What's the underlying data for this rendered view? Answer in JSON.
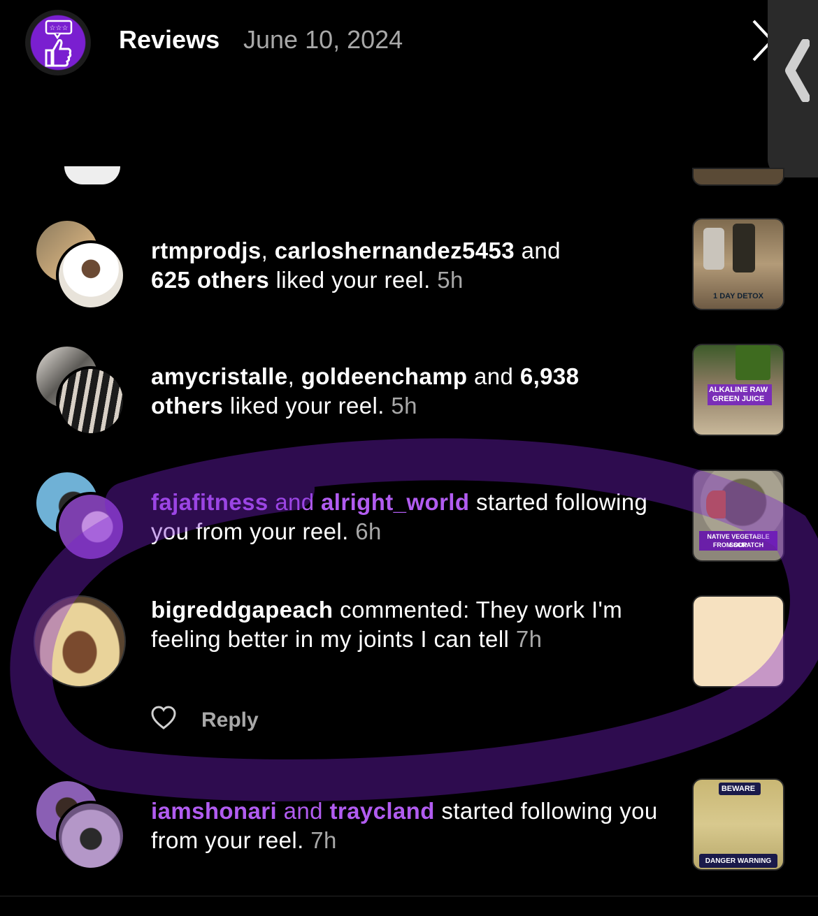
{
  "header": {
    "title": "Reviews",
    "date": "June 10, 2024"
  },
  "notifications": [
    {
      "user1": "rtmprodjs",
      "sep": ", ",
      "user2": "carloshernandez5453",
      "mid": " and ",
      "others": "625 others",
      "action": " liked your reel. ",
      "time": "5h",
      "thumb_caption": "1 DAY DETOX"
    },
    {
      "user1": "amycristalle",
      "sep": ", ",
      "user2": "goldeenchamp",
      "mid": " and ",
      "others_a": "6,938",
      "others_b": "others",
      "action": " liked your reel. ",
      "time": "5h",
      "thumb_caption_1": "ALKALINE RAW",
      "thumb_caption_2": "GREEN JUICE"
    },
    {
      "user1": "fajafitness",
      "mid": " and ",
      "user2": "alright_world",
      "action": " started following you from your reel. ",
      "time": "6h",
      "thumb_caption_1": "NATIVE VEGETABLE SOUP",
      "thumb_caption_2": "FROM SCRATCH"
    },
    {
      "user": "bigreddgapeach",
      "action": " commented: They work I'm feeling better in  my joints  I can tell ",
      "time": "7h",
      "reply_label": "Reply"
    },
    {
      "user1": "iamshonari",
      "mid": " and ",
      "user2": "traycland",
      "action": " started following you from your reel. ",
      "time": "7h",
      "thumb_caption_top": "BEWARE",
      "thumb_caption_bottom": "DANGER WARNING"
    }
  ],
  "colors": {
    "background": "#000000",
    "text": "#ffffff",
    "muted": "#a8a8a8",
    "highlight_purple": "#b15cf0",
    "logo_purple": "#7a1fd0"
  },
  "icons": [
    "reviews-logo-icon",
    "close-icon",
    "collapse-chevron-icon",
    "heart-icon"
  ]
}
